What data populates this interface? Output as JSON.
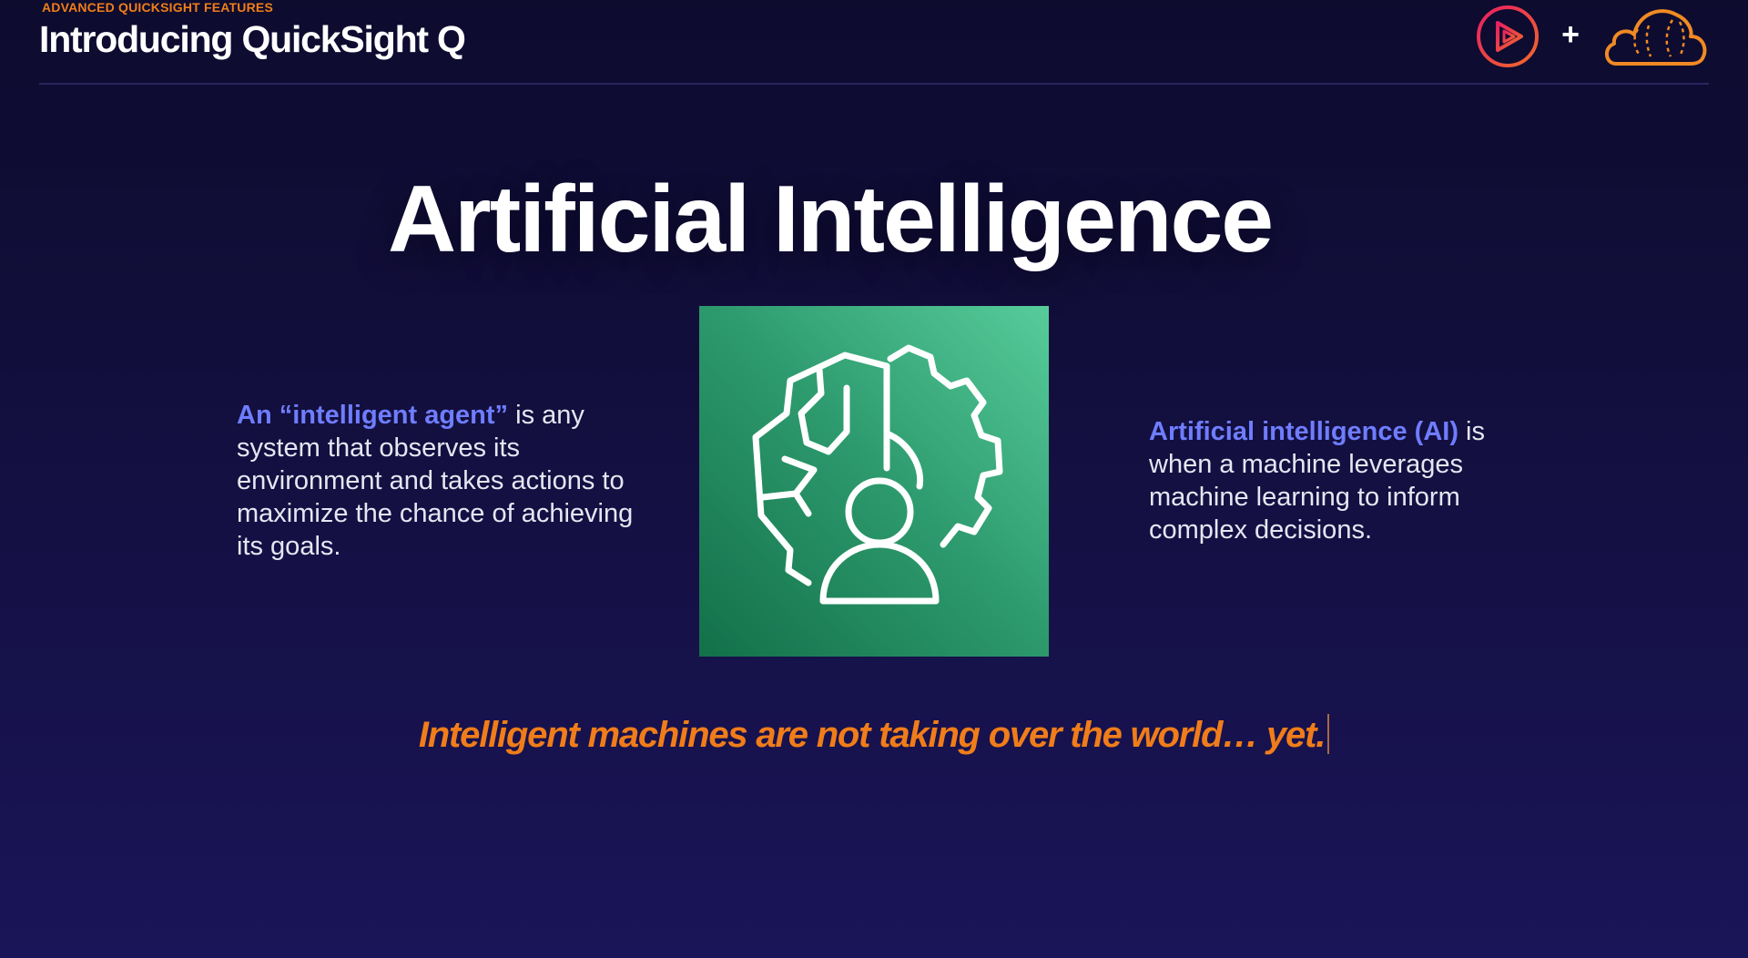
{
  "colors": {
    "background_top": "#0d0b2e",
    "background_bottom": "#1a1558",
    "orange_accent": "#f07d1a",
    "blue_accent": "#6f7dff",
    "tile_green": "#2d9a6d",
    "pluralsight_pink": "#e91e63"
  },
  "header": {
    "section_label": "ADVANCED QUICKSIGHT FEATURES",
    "title": "Introducing QuickSight Q",
    "logos": {
      "left_icon": "pluralsight-play-icon",
      "joiner": "+",
      "right_icon": "acg-cloud-icon"
    }
  },
  "slide": {
    "heading": "Artificial Intelligence",
    "left_block": {
      "accent": "An “intelligent agent”",
      "text": " is any system that observes its environment and takes actions to maximize the chance of achieving its goals."
    },
    "center_icon": "brain-gear-person-icon",
    "right_block": {
      "accent": "Artificial intelligence (AI)",
      "text": " is when a machine leverages machine learning to inform complex decisions."
    },
    "tagline": "Intelligent machines are not taking over the world… yet."
  }
}
